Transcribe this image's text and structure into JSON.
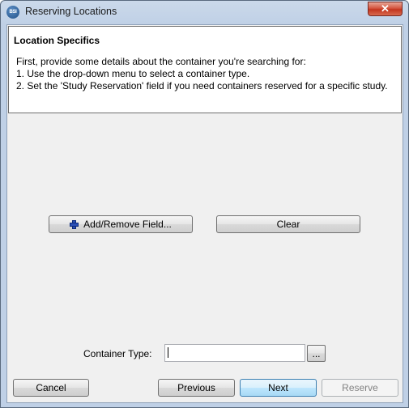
{
  "window": {
    "icon_text": "BSI",
    "title": "Reserving Locations",
    "close_label": "✕"
  },
  "info": {
    "title": "Location Specifics",
    "lines": [
      "First, provide some details about the container you're searching for:",
      "1. Use the drop-down menu to select a container type.",
      "2. Set the 'Study Reservation' field if you need containers reserved for a specific study."
    ]
  },
  "actions": {
    "add_remove_label": "Add/Remove Field...",
    "clear_label": "Clear"
  },
  "form": {
    "container_type_label": "Container Type:",
    "container_type_value": "",
    "browse_label": "..."
  },
  "footer": {
    "cancel_label": "Cancel",
    "previous_label": "Previous",
    "next_label": "Next",
    "reserve_label": "Reserve"
  }
}
